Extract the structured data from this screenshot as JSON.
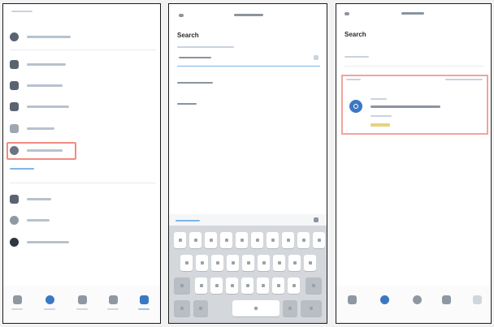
{
  "colors": {
    "accent": "#3b78c4",
    "highlight": "#f28b82",
    "icon_gray": "#5a6470"
  },
  "phone1": {
    "sidebar_items": [
      {
        "icon": "account-icon"
      },
      {
        "icon": "history-icon"
      },
      {
        "icon": "devices-icon"
      },
      {
        "icon": "security-icon"
      },
      {
        "icon": "display-icon"
      },
      {
        "icon": "find-device-icon"
      },
      {
        "icon": "settings-icon"
      },
      {
        "icon": "notifications-icon"
      },
      {
        "icon": "about-icon"
      }
    ],
    "tabbar": [
      {
        "icon": "home-tab-icon"
      },
      {
        "icon": "discover-tab-icon"
      },
      {
        "icon": "devices-tab-icon"
      },
      {
        "icon": "smart-tab-icon"
      },
      {
        "icon": "me-tab-icon"
      }
    ]
  },
  "phone2": {
    "title": "Search",
    "keyboard": {
      "row1_keys": 10,
      "row2_keys": 9,
      "row3_keys": 7
    }
  },
  "phone3": {
    "title": "Search"
  }
}
